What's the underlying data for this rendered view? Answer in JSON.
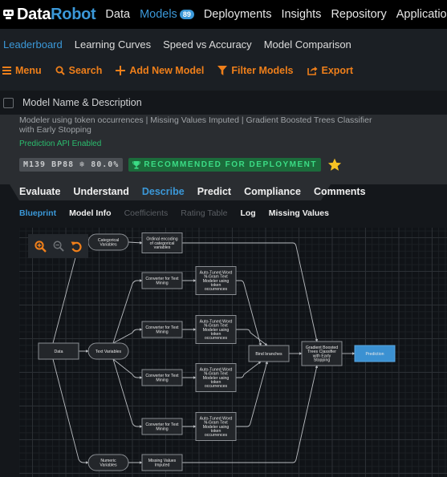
{
  "app": {
    "brand_first": "Data",
    "brand_second": "Robot",
    "brand_color": "#3b98d8",
    "accent_color": "#ef7f1a"
  },
  "topnav": {
    "items": [
      {
        "label": "Data",
        "active": false
      },
      {
        "label": "Models",
        "active": true,
        "badge": "89"
      },
      {
        "label": "Deployments",
        "active": false
      },
      {
        "label": "Insights",
        "active": false
      },
      {
        "label": "Repository",
        "active": false
      },
      {
        "label": "Applications",
        "active": false
      }
    ]
  },
  "subnav": {
    "tabs": [
      {
        "label": "Leaderboard",
        "active": true
      },
      {
        "label": "Learning Curves",
        "active": false
      },
      {
        "label": "Speed vs Accuracy",
        "active": false
      },
      {
        "label": "Model Comparison",
        "active": false
      }
    ]
  },
  "toolbar": {
    "menu": {
      "label": "Menu",
      "icon": "hamburger-icon"
    },
    "search": {
      "label": "Search",
      "icon": "search-icon"
    },
    "add_model": {
      "label": "Add New Model",
      "icon": "plus-icon"
    },
    "filter": {
      "label": "Filter Models",
      "icon": "filter-icon"
    },
    "export": {
      "label": "Export",
      "icon": "export-icon"
    }
  },
  "model_list": {
    "header": "Model Name & Description",
    "checked": false
  },
  "model": {
    "description": "Modeler using token occurrences | Missing Values Imputed | Gradient Boosted Trees Classifier with Early Stopping",
    "api_status": "Prediction API Enabled",
    "model_id": "M139",
    "blueprint_id": "BP88",
    "sample_pct": "80.0%",
    "recommendation": "RECOMMENDED FOR DEPLOYMENT",
    "starred": true
  },
  "model_tabs": [
    {
      "label": "Evaluate",
      "active": false
    },
    {
      "label": "Understand",
      "active": false
    },
    {
      "label": "Describe",
      "active": true
    },
    {
      "label": "Predict",
      "active": false
    },
    {
      "label": "Compliance",
      "active": false
    },
    {
      "label": "Comments",
      "active": false
    }
  ],
  "describe_tabs": [
    {
      "label": "Blueprint",
      "state": "active"
    },
    {
      "label": "Model Info",
      "state": "normal"
    },
    {
      "label": "Coefficients",
      "state": "disabled"
    },
    {
      "label": "Rating Table",
      "state": "disabled"
    },
    {
      "label": "Log",
      "state": "normal"
    },
    {
      "label": "Missing Values",
      "state": "normal"
    }
  ],
  "blueprint": {
    "zoom_controls": [
      "zoom-in-icon",
      "zoom-out-icon",
      "reset-icon"
    ],
    "nodes": {
      "data": [
        "Data"
      ],
      "categorical": [
        "Categorical",
        "Variables"
      ],
      "text": [
        "Text Variables"
      ],
      "numeric": [
        "Numeric",
        "Variables"
      ],
      "ordinal": [
        "Ordinal encoding",
        "of categorical",
        "variables"
      ],
      "conv1": [
        "Converter for Text",
        "Mining"
      ],
      "conv2": [
        "Converter for Text",
        "Mining"
      ],
      "conv3": [
        "Converter for Text",
        "Mining"
      ],
      "conv4": [
        "Converter for Text",
        "Mining"
      ],
      "ngram1": [
        "Auto-Tuned Word",
        "N-Gram Text",
        "Modeler using",
        "token",
        "occurrences"
      ],
      "ngram2": [
        "Auto-Tuned Word",
        "N-Gram Text",
        "Modeler using",
        "token",
        "occurrences"
      ],
      "ngram3": [
        "Auto-Tuned Word",
        "N-Gram Text",
        "Modeler using",
        "token",
        "occurrences"
      ],
      "ngram4": [
        "Auto-Tuned Word",
        "N-Gram Text",
        "Modeler using",
        "token",
        "occurrences"
      ],
      "missing": [
        "Missing Values",
        "Imputed"
      ],
      "bind": [
        "Bind branches"
      ],
      "gbt": [
        "Gradient Boosted",
        "Trees Classifier",
        "with Early",
        "Stopping"
      ],
      "prediction": [
        "Prediction"
      ]
    },
    "edges": [
      [
        "data",
        "categorical"
      ],
      [
        "data",
        "text"
      ],
      [
        "data",
        "numeric"
      ],
      [
        "categorical",
        "ordinal"
      ],
      [
        "text",
        "conv1"
      ],
      [
        "text",
        "conv2"
      ],
      [
        "text",
        "conv3"
      ],
      [
        "text",
        "conv4"
      ],
      [
        "numeric",
        "missing"
      ],
      [
        "conv1",
        "ngram1"
      ],
      [
        "conv2",
        "ngram2"
      ],
      [
        "conv3",
        "ngram3"
      ],
      [
        "conv4",
        "ngram4"
      ],
      [
        "ngram1",
        "bind"
      ],
      [
        "ngram2",
        "bind"
      ],
      [
        "ngram3",
        "bind"
      ],
      [
        "ngram4",
        "bind"
      ],
      [
        "ordinal",
        "gbt"
      ],
      [
        "bind",
        "gbt"
      ],
      [
        "missing",
        "gbt"
      ],
      [
        "gbt",
        "prediction"
      ]
    ]
  }
}
